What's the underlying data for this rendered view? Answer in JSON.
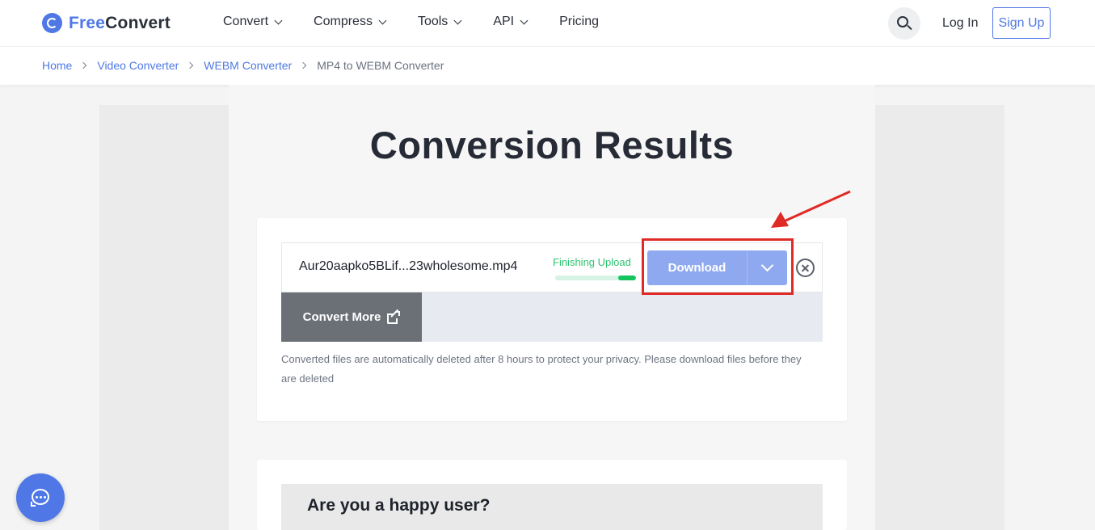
{
  "header": {
    "logo_free": "Free",
    "logo_convert": "Convert",
    "nav": [
      {
        "label": "Convert"
      },
      {
        "label": "Compress"
      },
      {
        "label": "Tools"
      },
      {
        "label": "API"
      },
      {
        "label": "Pricing"
      }
    ],
    "login_label": "Log In",
    "signup_label": "Sign Up"
  },
  "breadcrumb": {
    "items": [
      "Home",
      "Video Converter",
      "WEBM Converter"
    ],
    "current": "MP4 to WEBM Converter"
  },
  "main": {
    "title": "Conversion Results",
    "file": {
      "name": "Aur20aapko5BLif...23wholesome.mp4",
      "status": "Finishing Upload",
      "progress": 0.22,
      "download_label": "Download"
    },
    "convert_more_label": "Convert More",
    "note": "Converted files are automatically deleted after 8 hours to protect your privacy. Please download files before they are deleted"
  },
  "happy": {
    "title": "Are you a happy user?"
  },
  "colors": {
    "brand": "#4f78e6",
    "success": "#16c45f",
    "highlight": "#e02a26"
  }
}
